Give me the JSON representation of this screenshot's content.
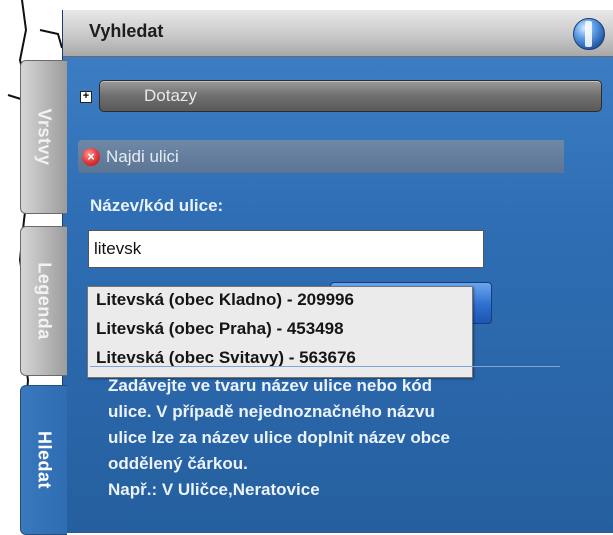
{
  "header": {
    "title": "Vyhledat",
    "globe_icon": "globe-icon"
  },
  "tabs": [
    {
      "label": "Vrstvy"
    },
    {
      "label": "Legenda"
    },
    {
      "label": "Hledat"
    }
  ],
  "dotazy": {
    "expand_symbol": "+",
    "label": "Dotazy"
  },
  "najdi": {
    "icon": "close-icon",
    "icon_glyph": "×",
    "label": "Najdi ulici"
  },
  "form": {
    "name_label": "Název/kód ulice:",
    "input_value": "litevsk"
  },
  "suggestions": [
    "Litevská (obec Kladno) - 209996",
    "Litevská (obec Praha) - 453498",
    "Litevská (obec Svitavy) - 563676"
  ],
  "help": {
    "line1": "Zadávejte ve tvaru název ulice nebo kód",
    "line2": "ulice. V případě nejednoznačného názvu",
    "line3": "ulice lze za název ulice doplnit název obce",
    "line4": "oddělený čárkou.",
    "line5": "Např.: V Uličce,Neratovice"
  },
  "colors": {
    "panel_blue": "#2f6eb4",
    "header_gray": "#c9c9c9",
    "button_blue": "#2d6fd0"
  }
}
